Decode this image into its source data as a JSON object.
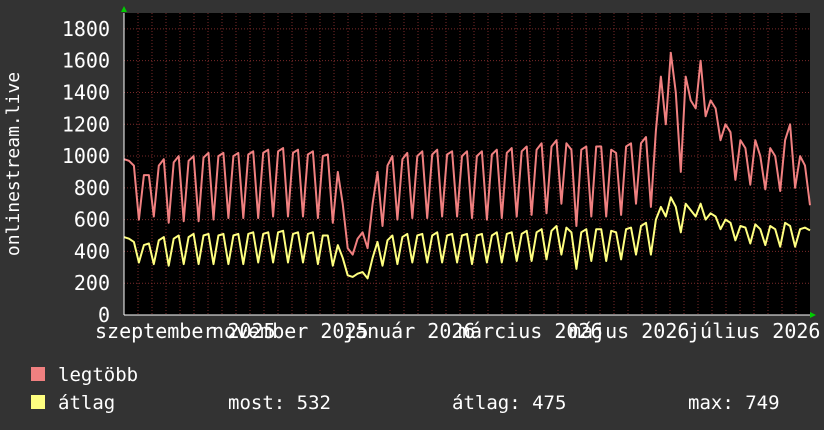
{
  "chart_data": {
    "type": "line",
    "ylabel": "onlinestream.live",
    "ylim": [
      0,
      1900
    ],
    "y_ticks": [
      0,
      200,
      400,
      600,
      800,
      1000,
      1200,
      1400,
      1600,
      1800
    ],
    "grid": true,
    "x_ticks": [
      "szeptember 2025",
      "november 2025",
      "január 2026",
      "március 2026",
      "május 2026",
      "július 2026"
    ],
    "colors": {
      "background": "#333333",
      "plot_background": "#000000",
      "grid": "#7a2a2a",
      "text": "#ffffff",
      "legtobb": "#f08080",
      "atlag": "#ffff80",
      "arrow": "#00cc00"
    },
    "series": [
      {
        "name": "legtöbb",
        "color": "#f08080",
        "values": [
          980,
          970,
          940,
          600,
          880,
          880,
          620,
          940,
          980,
          580,
          960,
          1000,
          590,
          970,
          1000,
          590,
          990,
          1020,
          600,
          1000,
          1020,
          610,
          1000,
          1020,
          610,
          1010,
          1030,
          610,
          1020,
          1040,
          620,
          1030,
          1050,
          620,
          1020,
          1040,
          620,
          1010,
          1030,
          610,
          1000,
          1010,
          580,
          900,
          700,
          420,
          380,
          480,
          520,
          420,
          700,
          900,
          560,
          940,
          1000,
          600,
          980,
          1020,
          610,
          1000,
          1030,
          610,
          1010,
          1040,
          620,
          1010,
          1030,
          620,
          1000,
          1030,
          610,
          1000,
          1030,
          600,
          1010,
          1040,
          610,
          1020,
          1050,
          620,
          1030,
          1060,
          630,
          1040,
          1080,
          640,
          1060,
          1100,
          700,
          1080,
          1040,
          560,
          1040,
          1060,
          620,
          1060,
          1060,
          620,
          1040,
          1020,
          630,
          1060,
          1080,
          700,
          1080,
          1120,
          680,
          1160,
          1500,
          1200,
          1650,
          1400,
          900,
          1500,
          1350,
          1300,
          1600,
          1250,
          1350,
          1300,
          1100,
          1200,
          1150,
          850,
          1100,
          1050,
          820,
          1100,
          1000,
          790,
          1050,
          1000,
          780,
          1100,
          1200,
          800,
          1000,
          940,
          690
        ]
      },
      {
        "name": "átlag",
        "color": "#ffff80",
        "values": [
          490,
          480,
          460,
          330,
          440,
          450,
          320,
          470,
          490,
          310,
          480,
          500,
          320,
          490,
          510,
          320,
          500,
          510,
          320,
          500,
          510,
          320,
          500,
          510,
          320,
          510,
          520,
          330,
          510,
          520,
          330,
          520,
          530,
          330,
          510,
          520,
          330,
          510,
          520,
          320,
          500,
          500,
          310,
          440,
          360,
          250,
          240,
          260,
          270,
          230,
          360,
          460,
          310,
          470,
          500,
          320,
          490,
          510,
          330,
          500,
          510,
          330,
          500,
          520,
          330,
          500,
          510,
          330,
          500,
          510,
          320,
          500,
          510,
          330,
          500,
          520,
          330,
          510,
          520,
          340,
          510,
          530,
          340,
          520,
          540,
          350,
          530,
          560,
          380,
          550,
          520,
          290,
          520,
          540,
          340,
          540,
          540,
          340,
          530,
          520,
          350,
          540,
          550,
          380,
          560,
          580,
          380,
          600,
          680,
          620,
          740,
          680,
          520,
          700,
          660,
          620,
          700,
          600,
          640,
          620,
          540,
          600,
          580,
          470,
          560,
          550,
          450,
          570,
          540,
          440,
          560,
          540,
          430,
          580,
          560,
          430,
          540,
          550,
          532
        ]
      }
    ]
  },
  "legend": {
    "items": [
      {
        "label": "legtöbb",
        "color": "#f08080"
      },
      {
        "label": "átlag",
        "color": "#ffff80"
      }
    ],
    "stats": {
      "most": "most: 532",
      "atlag": "átlag: 475",
      "max": "max: 749"
    }
  }
}
